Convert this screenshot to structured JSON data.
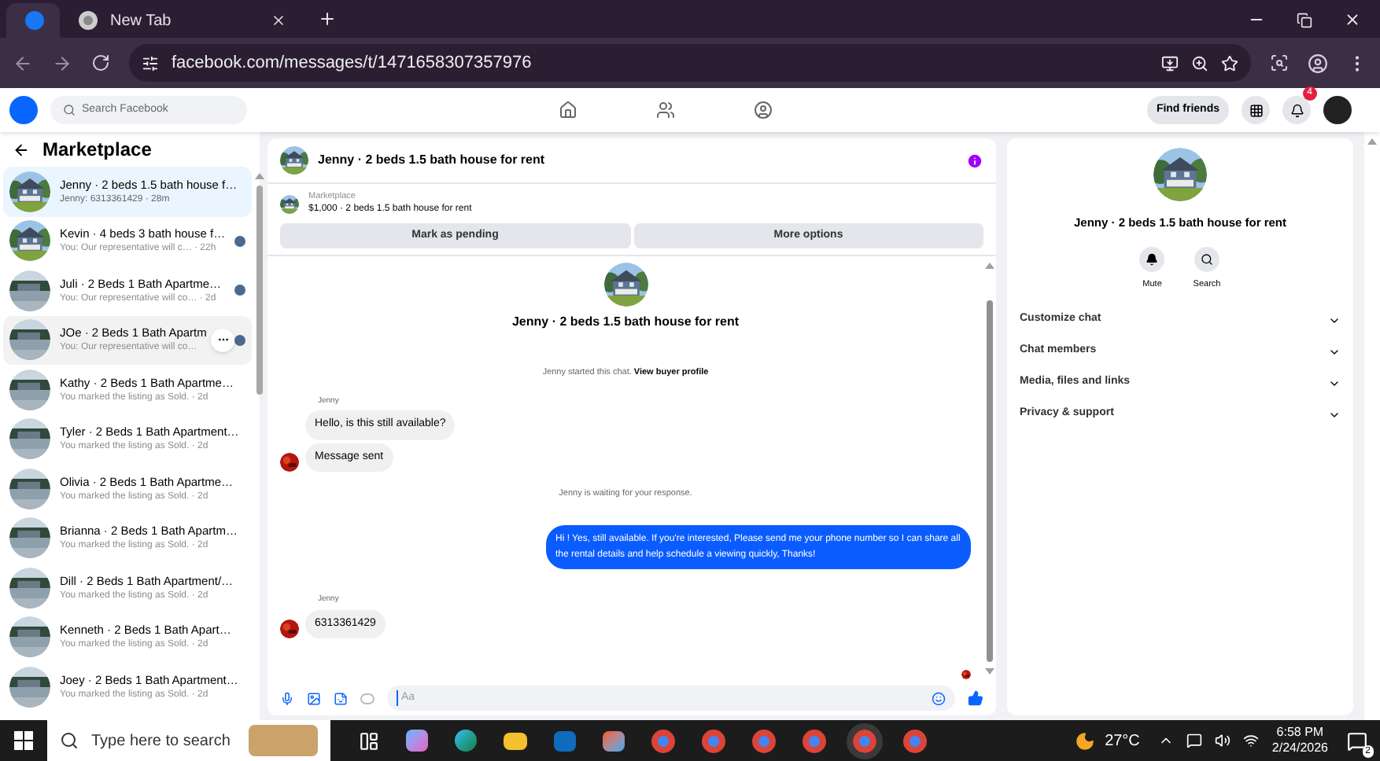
{
  "browser": {
    "tabs": [
      {
        "kind": "facebook",
        "selected": true
      },
      {
        "kind": "chrome",
        "title": "New Tab",
        "selected": false
      }
    ],
    "url": "facebook.com/messages/t/1471658307357976"
  },
  "facebook_nav": {
    "search": {
      "placeholder": "Search Facebook"
    },
    "find_friends": "Find friends",
    "notification_count": "4"
  },
  "sidebar": {
    "title": "Marketplace",
    "conversations": [
      {
        "title": "Jenny · 2 beds 1.5 bath house f…",
        "preview": "Jenny: 6313361429 · 28m",
        "selected": true,
        "hovered": false,
        "seen": false
      },
      {
        "title": "Kevin · 4 beds 3 bath house f…",
        "preview": "You: Our representative will c… · 22h",
        "selected": false,
        "hovered": false,
        "seen": true
      },
      {
        "title": "Juli · 2 Beds 1 Bath Apartme…",
        "preview": "You: Our representative will co… · 2d",
        "selected": false,
        "hovered": false,
        "seen": true
      },
      {
        "title": "JOe · 2 Beds 1 Bath Apartm",
        "preview": "You: Our representative will co…",
        "selected": false,
        "hovered": true,
        "seen": true
      },
      {
        "title": "Kathy · 2 Beds 1 Bath Apartme…",
        "preview": "You marked the listing as Sold. · 2d",
        "selected": false,
        "hovered": false,
        "seen": false
      },
      {
        "title": "Tyler · 2 Beds 1 Bath Apartment…",
        "preview": "You marked the listing as Sold. · 2d",
        "selected": false,
        "hovered": false,
        "seen": false
      },
      {
        "title": "Olivia · 2 Beds 1 Bath Apartme…",
        "preview": "You marked the listing as Sold. · 2d",
        "selected": false,
        "hovered": false,
        "seen": false
      },
      {
        "title": "Brianna · 2 Beds 1 Bath Apartm…",
        "preview": "You marked the listing as Sold. · 2d",
        "selected": false,
        "hovered": false,
        "seen": false
      },
      {
        "title": "Dill · 2 Beds 1 Bath Apartment/…",
        "preview": "You marked the listing as Sold. · 2d",
        "selected": false,
        "hovered": false,
        "seen": false
      },
      {
        "title": "Kenneth · 2 Beds 1 Bath Apart…",
        "preview": "You marked the listing as Sold. · 2d",
        "selected": false,
        "hovered": false,
        "seen": false
      },
      {
        "title": "Joey · 2 Beds 1 Bath Apartment…",
        "preview": "You marked the listing as Sold. · 2d",
        "selected": false,
        "hovered": false,
        "seen": false
      }
    ]
  },
  "chat": {
    "title": "Jenny · 2 beds 1.5 bath house for rent",
    "listing": {
      "label": "Marketplace",
      "summary": "$1,000 · 2 beds 1.5 bath house for rent"
    },
    "buttons": [
      "Mark as pending",
      "More options"
    ],
    "messages": [
      {
        "kind": "intro",
        "text": "Jenny · 2 beds 1.5 bath house for rent"
      },
      {
        "kind": "system",
        "text": "Jenny started this chat.",
        "link": "View buyer profile"
      },
      {
        "kind": "incoming",
        "sender": "Jenny",
        "bubbles": [
          "Hello, is this still available?",
          "Message sent"
        ]
      },
      {
        "kind": "system",
        "text": "Jenny is waiting for your response."
      },
      {
        "kind": "outgoing",
        "bubbles": [
          "Hi ! Yes, still available. If you're interested, Please send me your phone number so I can share all the rental details and help schedule a viewing quickly, Thanks!"
        ]
      },
      {
        "kind": "incoming",
        "sender": "Jenny",
        "bubbles": [
          "6313361429"
        ]
      }
    ],
    "composer": {
      "placeholder": "Aa"
    }
  },
  "details": {
    "title": "Jenny · 2 beds 1.5 bath house for rent",
    "actions": [
      {
        "kind": "mute",
        "label": "Mute"
      },
      {
        "kind": "search",
        "label": "Search"
      }
    ],
    "sections": [
      {
        "label": "Customize chat",
        "expanded": false
      },
      {
        "label": "Chat members",
        "expanded": false
      },
      {
        "label": "Media, files and links",
        "expanded": false
      },
      {
        "label": "Privacy & support",
        "expanded": false
      }
    ]
  },
  "taskbar": {
    "search": {
      "placeholder": "Type here to search"
    },
    "temperature": "27°C",
    "time": "6:58 PM",
    "date": "2/24/2026",
    "notification_count": "2"
  }
}
